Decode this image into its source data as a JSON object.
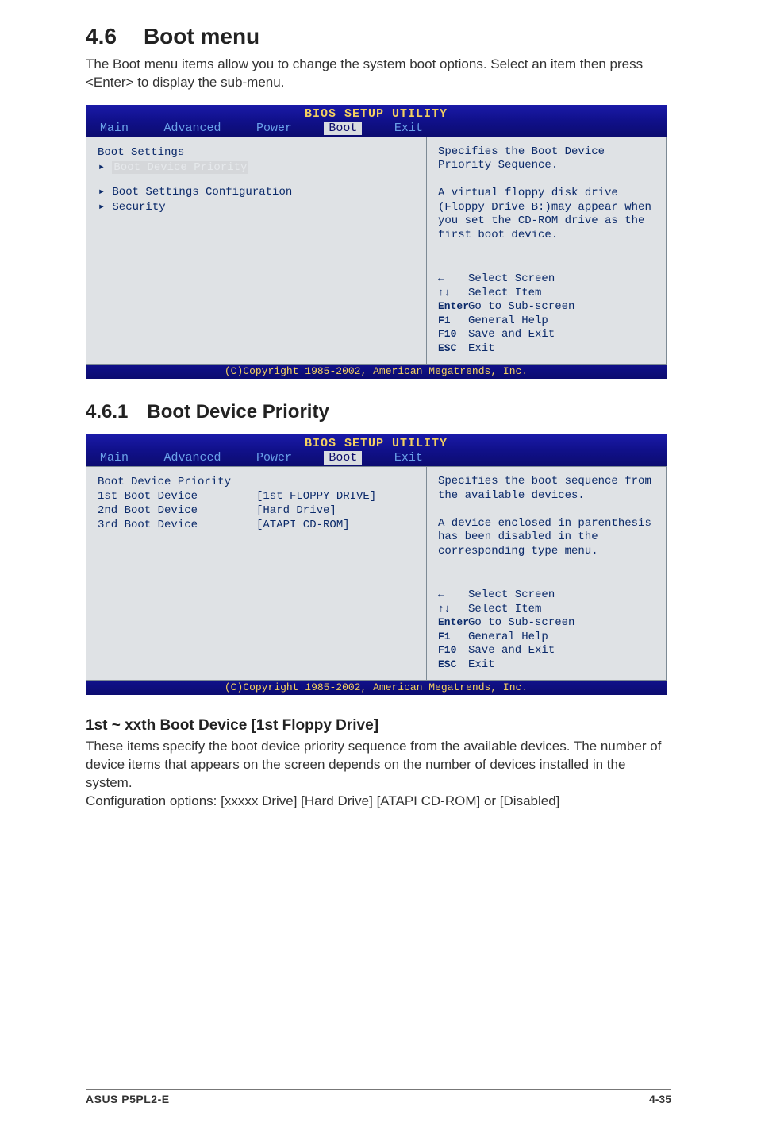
{
  "section": {
    "number": "4.6",
    "title": "Boot menu",
    "description": "The Boot menu items allow you to change the system boot options. Select an item then press <Enter> to display the sub-menu."
  },
  "bios1": {
    "headerTitle": "BIOS SETUP UTILITY",
    "tabs": {
      "main": "Main",
      "advanced": "Advanced",
      "power": "Power",
      "boot": "Boot",
      "exit": "Exit"
    },
    "left": {
      "heading": "Boot Settings",
      "item_priority": "Boot Device Priority",
      "item_config": "Boot Settings Configuration",
      "item_security": "Security"
    },
    "help": "Specifies the Boot Device Priority Sequence.\n\nA virtual floppy disk drive (Floppy Drive B:)may appear when you set the CD-ROM drive as the first boot device.",
    "keys": {
      "k1a": "←",
      "k1b": "Select Screen",
      "k2a": "↑↓",
      "k2b": "Select Item",
      "k3a": "Enter",
      "k3b": "Go to Sub-screen",
      "k4a": "F1",
      "k4b": "General Help",
      "k5a": "F10",
      "k5b": "Save and Exit",
      "k6a": "ESC",
      "k6b": "Exit"
    },
    "footer": "(C)Copyright 1985-2002, American Megatrends, Inc."
  },
  "sub": {
    "number": "4.6.1",
    "title": "Boot Device Priority"
  },
  "bios2": {
    "headerTitle": "BIOS SETUP UTILITY",
    "tabs": {
      "main": "Main",
      "advanced": "Advanced",
      "power": "Power",
      "boot": "Boot",
      "exit": "Exit"
    },
    "left": {
      "heading": "Boot Device Priority",
      "r1a": "1st Boot Device",
      "r1b": "[1st FLOPPY DRIVE]",
      "r2a": "2nd Boot Device",
      "r2b": "[Hard Drive]",
      "r3a": "3rd Boot Device",
      "r3b": "[ATAPI CD-ROM]"
    },
    "help": "Specifies the boot sequence from the available devices.\n\nA device enclosed in parenthesis has been disabled in the corresponding type menu.",
    "keys": {
      "k1a": "←",
      "k1b": "Select Screen",
      "k2a": "↑↓",
      "k2b": "Select Item",
      "k3a": "Enter",
      "k3b": "Go to Sub-screen",
      "k4a": "F1",
      "k4b": "General Help",
      "k5a": "F10",
      "k5b": "Save and Exit",
      "k6a": "ESC",
      "k6b": "Exit"
    },
    "footer": "(C)Copyright 1985-2002, American Megatrends, Inc."
  },
  "option": {
    "title": "1st ~ xxth Boot Device [1st Floppy Drive]",
    "desc": "These items specify the boot device priority sequence from the available devices. The number of device items that appears on the screen depends on the number of devices installed in the system.\nConfiguration options: [xxxxx Drive] [Hard Drive] [ATAPI CD-ROM] or [Disabled]"
  },
  "footer": {
    "left": "ASUS P5PL2-E",
    "right": "4-35"
  }
}
